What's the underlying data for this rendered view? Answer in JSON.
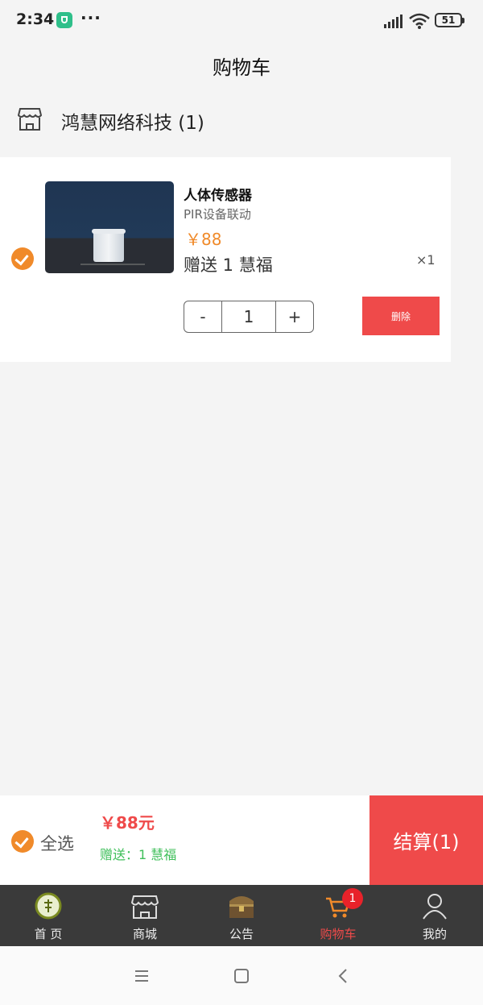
{
  "status": {
    "time": "2:34",
    "battery": "51"
  },
  "header": {
    "title": "购物车"
  },
  "shop": {
    "name": "鸿慧网络科技 (1)"
  },
  "item": {
    "name": "人体传感器",
    "subtitle": "PIR设备联动",
    "price": "￥88",
    "gift": "赠送 1 慧福",
    "qty_label": "×1",
    "quantity": "1",
    "minus_label": "-",
    "plus_label": "+",
    "delete_label": "删除"
  },
  "checkout": {
    "select_all_label": "全选",
    "total": "￥88元",
    "gift_total": "赠送：1 慧福",
    "button_label": "结算(1)"
  },
  "tabs": [
    {
      "label": "首 页",
      "icon": "home-icon"
    },
    {
      "label": "商城",
      "icon": "store-icon"
    },
    {
      "label": "公告",
      "icon": "chest-icon"
    },
    {
      "label": "购物车",
      "icon": "cart-icon",
      "badge": "1",
      "active": true
    },
    {
      "label": "我的",
      "icon": "user-icon"
    }
  ],
  "colors": {
    "accent": "#ef4a4a",
    "check": "#f08a2a",
    "gift": "#3fbf5a",
    "tabbar": "#3a3a3a"
  }
}
